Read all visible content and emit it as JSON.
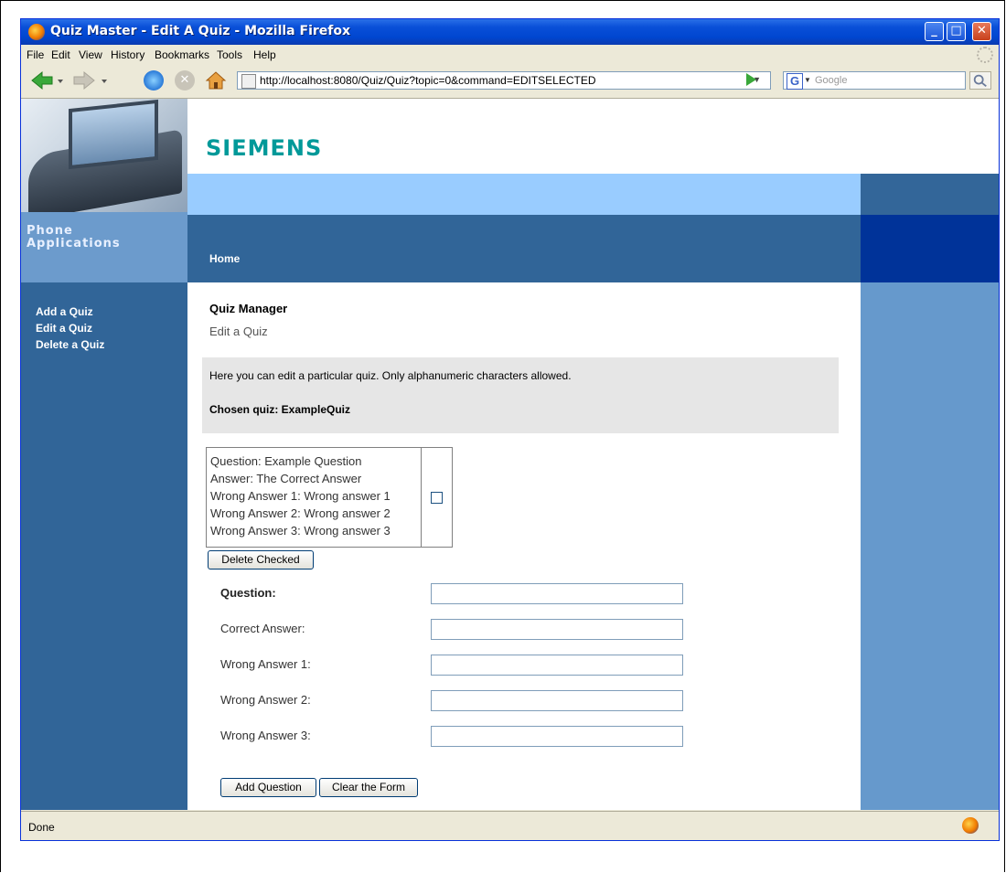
{
  "window": {
    "title": "Quiz Master - Edit A Quiz - Mozilla Firefox",
    "min": "_",
    "max": "□",
    "close": "✕"
  },
  "menu": {
    "items": [
      "File",
      "Edit",
      "View",
      "History",
      "Bookmarks",
      "Tools",
      "Help"
    ]
  },
  "toolbar": {
    "url": "http://localhost:8080/Quiz/Quiz?topic=0&command=EDITSELECTED",
    "search_placeholder": "Google",
    "stop": "✕"
  },
  "banner": {
    "logo": "SIEMENS",
    "phone_label_line1": "Phone",
    "phone_label_line2": "Applications",
    "home_link": "Home"
  },
  "sidebar": {
    "items": [
      "Add a Quiz",
      "Edit a Quiz",
      "Delete a Quiz"
    ]
  },
  "main": {
    "heading": "Quiz Manager",
    "subheading": "Edit a Quiz",
    "info": "Here you can edit a particular quiz. Only alphanumeric characters allowed.",
    "chosen": "Chosen quiz: ExampleQuiz",
    "question_lines": [
      "Question: Example Question",
      "Answer: The Correct Answer",
      "Wrong Answer 1: Wrong answer 1",
      "Wrong Answer 2: Wrong answer 2",
      "Wrong Answer 3: Wrong answer 3"
    ],
    "question_checked": false,
    "delete_checked_label": "Delete Checked",
    "form": {
      "question_label": "Question:",
      "correct_answer_label": "Correct Answer:",
      "wrong1_label": "Wrong Answer 1:",
      "wrong2_label": "Wrong Answer 2:",
      "wrong3_label": "Wrong Answer 3:",
      "question_value": "",
      "correct_answer_value": "",
      "wrong1_value": "",
      "wrong2_value": "",
      "wrong3_value": ""
    },
    "add_question_label": "Add Question",
    "clear_form_label": "Clear the Form"
  },
  "status": {
    "text": "Done"
  },
  "colors": {
    "sidebar_blue": "#316598",
    "light_band": "#99ccff",
    "right_column": "#6699cc",
    "siemens_teal": "#009999"
  }
}
